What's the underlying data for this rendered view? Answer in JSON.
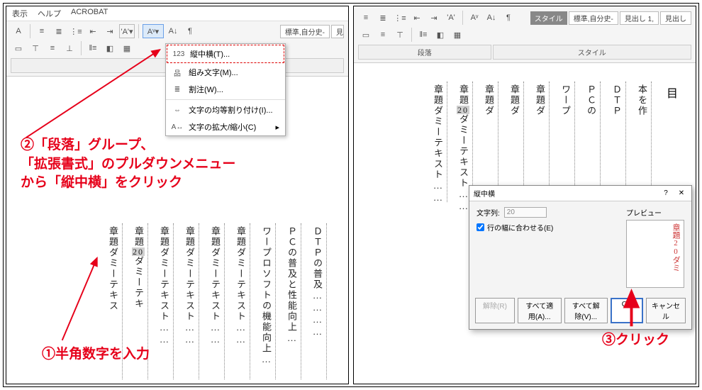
{
  "menu": {
    "view": "表示",
    "help": "ヘルプ",
    "acrobat": "ACROBAT"
  },
  "ribbon": {
    "group_para": "段落",
    "group_style": "スタイル",
    "style_label": "スタイル",
    "style_items": [
      "標準,自分史-",
      "見出し 1,",
      "見出し"
    ]
  },
  "dropdown": {
    "tatechuyoko": "縦中横(T)...",
    "kumimoji": "組み文字(M)...",
    "warichu": "割注(W)...",
    "kinto": "文字の均等割り付け(I)...",
    "kakudai": "文字の拡大/縮小(C)"
  },
  "doc": {
    "cols_left": [
      "ＤＴＰの普及…………",
      "ＰＣの普及と性能向上…",
      "ワープロソフトの機能向上…",
      "章題ダミーテキスト……",
      "章題ダミーテキスト……",
      "章題ダミーテキスト……",
      "章題ダミーテキスト……",
      "章題ダミーテキス",
      "章題ダミーテキス"
    ],
    "sel_col_index": 7,
    "sel_num": "20",
    "cols_right": [
      "本を作",
      "ＤＴＰ",
      "ＰＣの",
      "ワープ",
      "章題ダ",
      "章題ダ",
      "章題ダ",
      "章題ダミーテキスト……",
      "章題ダミーテキスト……"
    ],
    "sel_col_index_right": 7,
    "toc_label": "目"
  },
  "dialog": {
    "title": "縦中横",
    "label_moji": "文字列:",
    "value_moji": "20",
    "checkbox": "行の幅に合わせる(E)",
    "preview_label": "プレビュー",
    "preview_text": "章題20ダミ",
    "btn_kaijo": "解除(R)",
    "btn_all_apply": "すべて適用(A)...",
    "btn_all_kaijo": "すべて解除(V)...",
    "btn_ok": "OK",
    "btn_cancel": "キャンセル"
  },
  "anno": {
    "step1": "①半角数字を入力",
    "step2_l1": "②「段落」グループ、",
    "step2_l2": "「拡張書式」のプルダウンメニュー",
    "step2_l3": "から「縦中横」をクリック",
    "step3": "③クリック"
  }
}
